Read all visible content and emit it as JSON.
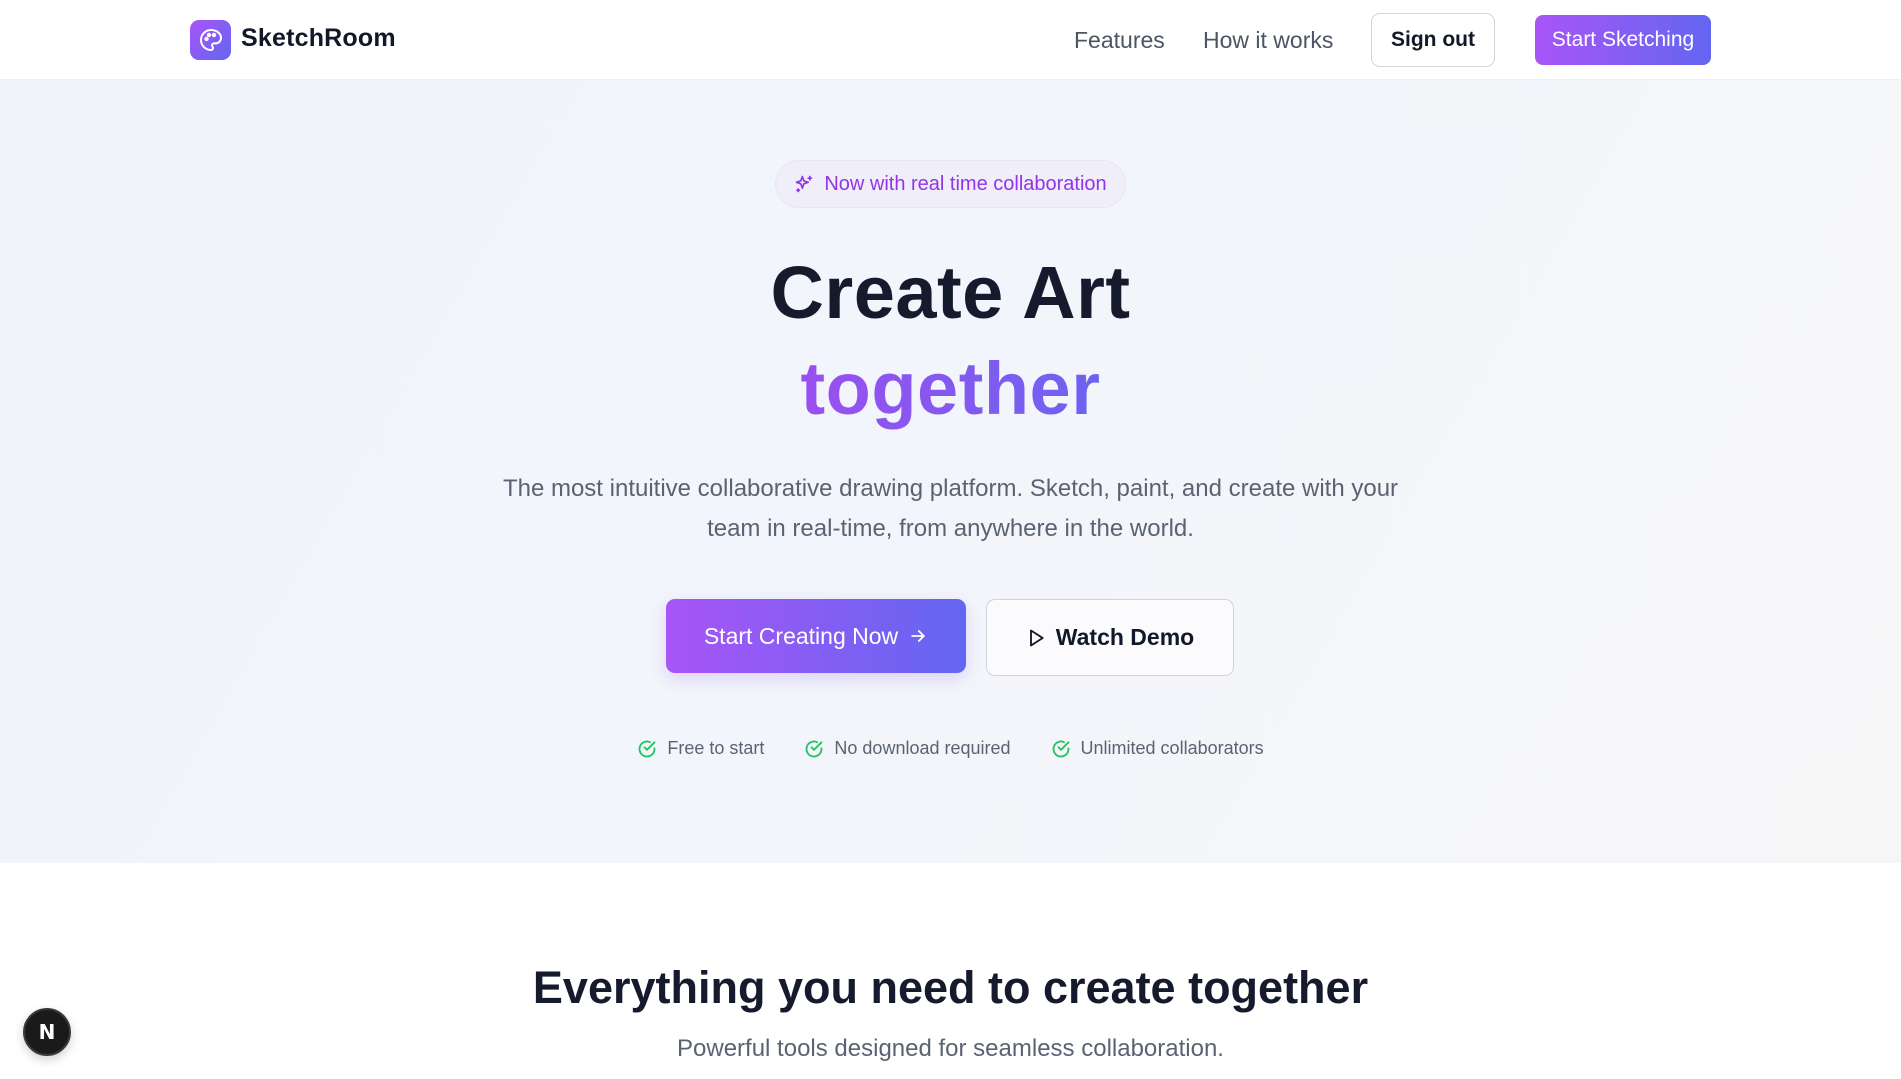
{
  "nav": {
    "brand": "SketchRoom",
    "links": [
      "Features",
      "How it works"
    ],
    "sign_out_label": "Sign out",
    "start_sketching_label": "Start Sketching"
  },
  "hero": {
    "badge_text": "Now with real time collaboration",
    "title_line1": "Create Art",
    "title_line2": "together",
    "subtitle": "The most intuitive collaborative drawing platform. Sketch, paint, and create with your team in real-time, from anywhere in the world.",
    "primary_cta": "Start Creating Now",
    "secondary_cta": "Watch Demo",
    "checks": [
      "Free to start",
      "No download required",
      "Unlimited collaborators"
    ]
  },
  "features": {
    "title": "Everything you need to create together",
    "subtitle": "Powerful tools designed for seamless collaboration."
  },
  "dev_badge": {
    "letter": "N"
  },
  "colors": {
    "accent_purple": "#a855f7",
    "accent_indigo": "#6366f1",
    "check_green": "#22c55e",
    "text_dark": "#151a2c"
  },
  "icons": {
    "logo": "palette-icon",
    "badge": "sparkles-icon",
    "primary_cta": "arrow-right-icon",
    "secondary_cta": "play-icon",
    "checks": "check-circle-icon"
  }
}
